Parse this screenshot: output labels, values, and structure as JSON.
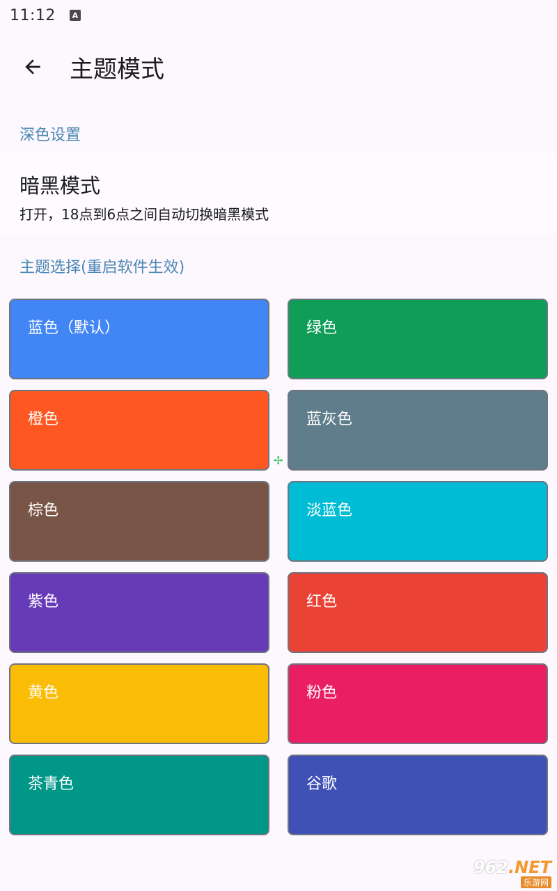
{
  "status_bar": {
    "time": "11:12",
    "notification_icon": "A"
  },
  "app_bar": {
    "back_icon": "arrow-left-icon",
    "title": "主题模式"
  },
  "dark_section": {
    "header": "深色设置",
    "item": {
      "title": "暗黑模式",
      "description": "打开，18点到6点之间自动切换暗黑模式"
    }
  },
  "theme_section": {
    "header": "主题选择(重启软件生效)",
    "themes": [
      {
        "label": "蓝色（默认）",
        "color": "#4285f4"
      },
      {
        "label": "绿色",
        "color": "#0f9d58"
      },
      {
        "label": "橙色",
        "color": "#ff5722"
      },
      {
        "label": "蓝灰色",
        "color": "#607d8b"
      },
      {
        "label": "棕色",
        "color": "#795548"
      },
      {
        "label": "淡蓝色",
        "color": "#00bcd4"
      },
      {
        "label": "紫色",
        "color": "#673ab7"
      },
      {
        "label": "红色",
        "color": "#ea4335"
      },
      {
        "label": "黄色",
        "color": "#fbbc05"
      },
      {
        "label": "粉色",
        "color": "#e91e63"
      },
      {
        "label": "茶青色",
        "color": "#009688"
      },
      {
        "label": "谷歌",
        "color": "#3f51b5"
      }
    ]
  },
  "watermark": {
    "brand_prefix": "962",
    "brand_suffix": ".NET",
    "subtitle": "乐游网"
  }
}
